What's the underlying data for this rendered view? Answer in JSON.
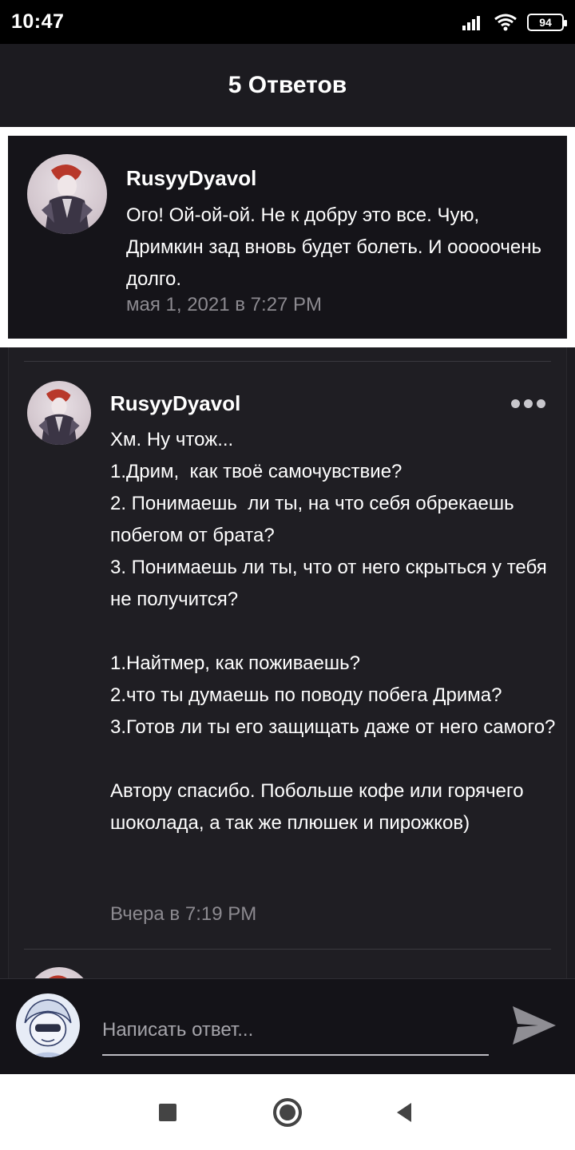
{
  "status_bar": {
    "time": "10:47",
    "battery_level": "94",
    "icons": [
      "signal-icon",
      "wifi-icon",
      "battery-icon"
    ]
  },
  "header": {
    "title": "5 Ответов"
  },
  "parent_comment": {
    "author": "RusyyDyavol",
    "text": "Ого! Ой-ой-ой. Не к добру это все. Чую, Дримкин зад вновь будет болеть. И ооооочень долго.",
    "time": "мая 1, 2021 в 7:27 PM"
  },
  "replies": [
    {
      "author": "RusyyDyavol",
      "text": "Хм. Ну чтож...\n1.Дрим,  как твоё самочувствие?\n2. Понимаешь  ли ты, на что себя обрекаешь побегом от брата?\n3. Понимаешь ли ты, что от него скрыться у тебя не получится?\n\n1.Найтмер, как поживаешь?\n2.что ты думаешь по поводу побега Дрима?\n3.Готов ли ты его защищать даже от него самого?\n\nАвтору спасибо. Побольше кофе или горячего шоколада, а так же плюшек и пирожков)",
      "time": "Вчера в 7:19 PM"
    }
  ],
  "composer": {
    "placeholder": "Написать ответ..."
  },
  "colors": {
    "background": "#1b1a1f",
    "card": "#151419",
    "muted_text": "#8c8a90",
    "highlight_frame": "#ffffff"
  }
}
